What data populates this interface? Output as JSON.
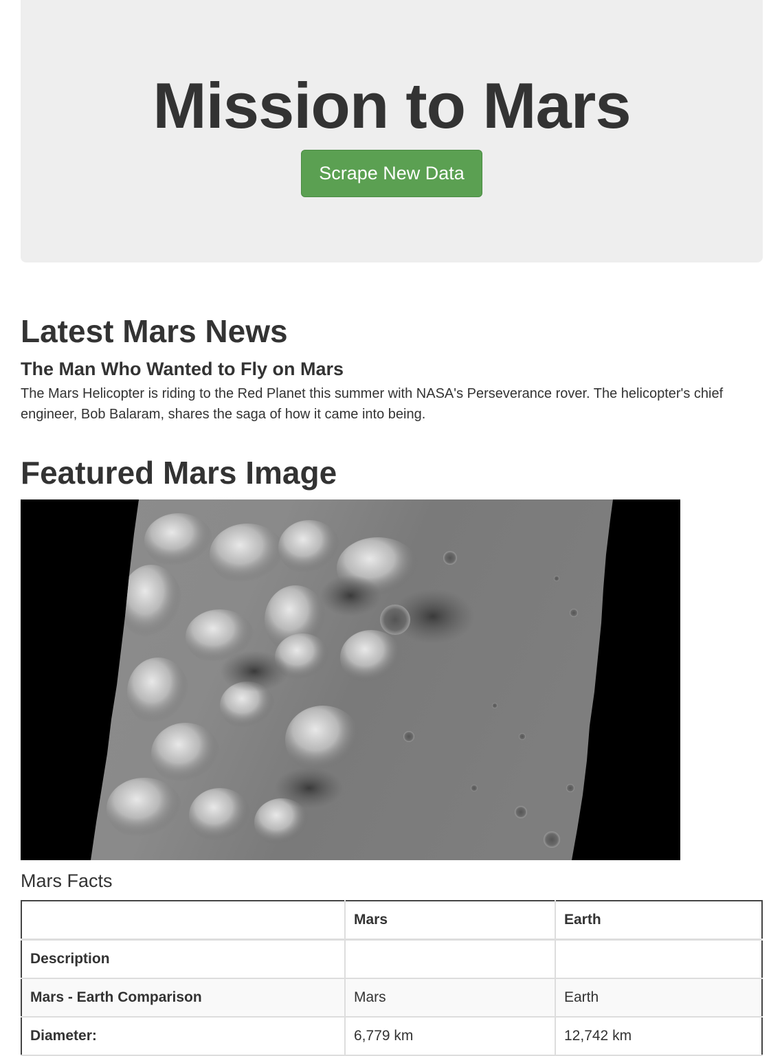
{
  "header": {
    "title": "Mission to Mars",
    "scrape_button": "Scrape New Data"
  },
  "news": {
    "heading": "Latest Mars News",
    "title": "The Man Who Wanted to Fly on Mars",
    "paragraph": "The Mars Helicopter is riding to the Red Planet this summer with NASA's Perseverance rover. The helicopter's chief engineer, Bob Balaram, shares the saga of how it came into being."
  },
  "featured_image": {
    "heading": "Featured Mars Image",
    "alt": "Grayscale orbital image of Martian terrain"
  },
  "facts": {
    "heading": "Mars Facts",
    "columns": [
      "",
      "Mars",
      "Earth"
    ],
    "rows": [
      {
        "label": "Description",
        "mars": "",
        "earth": ""
      },
      {
        "label": "Mars - Earth Comparison",
        "mars": "Mars",
        "earth": "Earth"
      },
      {
        "label": "Diameter:",
        "mars": "6,779 km",
        "earth": "12,742 km"
      }
    ]
  }
}
